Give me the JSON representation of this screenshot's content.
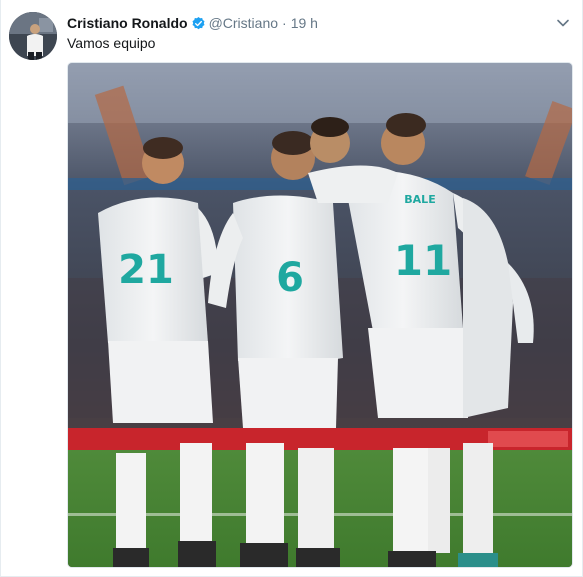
{
  "tweet": {
    "author_name": "Cristiano Ronaldo",
    "handle": "@Cristiano",
    "separator": "·",
    "time": "19 h",
    "text": "Vamos equipo",
    "icons": {
      "verified": "verified-badge-icon",
      "more": "chevron-down-icon"
    },
    "media": {
      "jersey_numbers": [
        "21",
        "6",
        "11"
      ],
      "jersey_names": [
        "BALE"
      ]
    }
  },
  "colors": {
    "name": "#14171a",
    "secondary": "#657786",
    "verified": "#1da1f2",
    "jersey_accent": "#1fa8a0"
  }
}
